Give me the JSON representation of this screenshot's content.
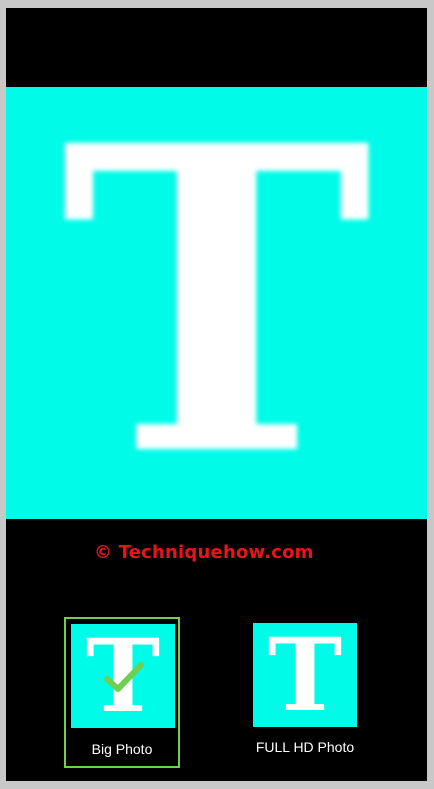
{
  "preview": {
    "letter": "T",
    "background": "#00fbe8"
  },
  "watermark": {
    "text": "© Techniquehow.com",
    "color": "#e8141b"
  },
  "options": [
    {
      "letter": "T",
      "label": "Big Photo",
      "selected": true,
      "icon": "check-icon"
    },
    {
      "letter": "T",
      "label": "FULL HD Photo",
      "selected": false
    }
  ],
  "colors": {
    "accent": "#6fd04f",
    "frame": "#000000"
  }
}
